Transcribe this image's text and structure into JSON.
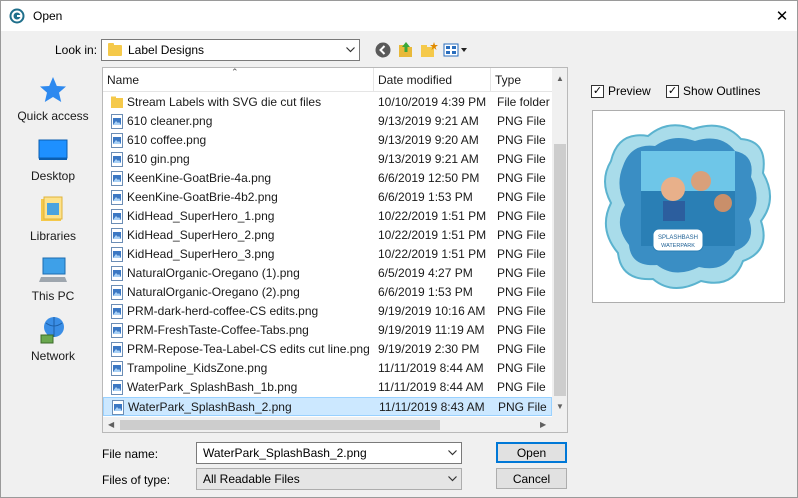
{
  "window": {
    "title": "Open",
    "close_glyph": "✕"
  },
  "look_in": {
    "label": "Look in:",
    "value": "Label Designs"
  },
  "toolbar": {
    "back_icon": "back-arrow-icon",
    "up_icon": "up-folder-icon",
    "new_folder_icon": "new-folder-icon",
    "view_icon": "view-menu-icon"
  },
  "places": [
    {
      "label": "Quick access",
      "icon": "star-icon"
    },
    {
      "label": "Desktop",
      "icon": "desktop-icon"
    },
    {
      "label": "Libraries",
      "icon": "libraries-icon"
    },
    {
      "label": "This PC",
      "icon": "computer-icon"
    },
    {
      "label": "Network",
      "icon": "network-icon"
    }
  ],
  "columns": {
    "name": "Name",
    "date": "Date modified",
    "type": "Type"
  },
  "files": [
    {
      "name": "Stream Labels with SVG die cut files",
      "date": "10/10/2019 4:39 PM",
      "type": "File folder",
      "kind": "folder"
    },
    {
      "name": "610 cleaner.png",
      "date": "9/13/2019 9:21 AM",
      "type": "PNG File",
      "kind": "png"
    },
    {
      "name": "610 coffee.png",
      "date": "9/13/2019 9:20 AM",
      "type": "PNG File",
      "kind": "png"
    },
    {
      "name": "610 gin.png",
      "date": "9/13/2019 9:21 AM",
      "type": "PNG File",
      "kind": "png"
    },
    {
      "name": "KeenKine-GoatBrie-4a.png",
      "date": "6/6/2019 12:50 PM",
      "type": "PNG File",
      "kind": "png"
    },
    {
      "name": "KeenKine-GoatBrie-4b2.png",
      "date": "6/6/2019 1:53 PM",
      "type": "PNG File",
      "kind": "png"
    },
    {
      "name": "KidHead_SuperHero_1.png",
      "date": "10/22/2019 1:51 PM",
      "type": "PNG File",
      "kind": "png"
    },
    {
      "name": "KidHead_SuperHero_2.png",
      "date": "10/22/2019 1:51 PM",
      "type": "PNG File",
      "kind": "png"
    },
    {
      "name": "KidHead_SuperHero_3.png",
      "date": "10/22/2019 1:51 PM",
      "type": "PNG File",
      "kind": "png"
    },
    {
      "name": "NaturalOrganic-Oregano (1).png",
      "date": "6/5/2019 4:27 PM",
      "type": "PNG File",
      "kind": "png"
    },
    {
      "name": "NaturalOrganic-Oregano (2).png",
      "date": "6/6/2019 1:53 PM",
      "type": "PNG File",
      "kind": "png"
    },
    {
      "name": "PRM-dark-herd-coffee-CS edits.png",
      "date": "9/19/2019 10:16 AM",
      "type": "PNG File",
      "kind": "png"
    },
    {
      "name": "PRM-FreshTaste-Coffee-Tabs.png",
      "date": "9/19/2019 11:19 AM",
      "type": "PNG File",
      "kind": "png"
    },
    {
      "name": "PRM-Repose-Tea-Label-CS edits cut line.png",
      "date": "9/19/2019 2:30 PM",
      "type": "PNG File",
      "kind": "png"
    },
    {
      "name": "Trampoline_KidsZone.png",
      "date": "11/11/2019 8:44 AM",
      "type": "PNG File",
      "kind": "png"
    },
    {
      "name": "WaterPark_SplashBash_1b.png",
      "date": "11/11/2019 8:44 AM",
      "type": "PNG File",
      "kind": "png"
    },
    {
      "name": "WaterPark_SplashBash_2.png",
      "date": "11/11/2019 8:43 AM",
      "type": "PNG File",
      "kind": "png",
      "selected": true
    }
  ],
  "options": {
    "preview_label": "Preview",
    "preview_checked": true,
    "outlines_label": "Show Outlines",
    "outlines_checked": true
  },
  "preview_image": {
    "logo_line1": "SPLASHBASH",
    "logo_line2": "WATERPARK"
  },
  "file_name": {
    "label": "File name:",
    "value": "WaterPark_SplashBash_2.png"
  },
  "file_type": {
    "label": "Files of type:",
    "value": "All Readable Files"
  },
  "buttons": {
    "open": "Open",
    "cancel": "Cancel"
  },
  "colors": {
    "selection": "#cce8ff",
    "accent": "#0078d7",
    "folder": "#f5c94a"
  }
}
